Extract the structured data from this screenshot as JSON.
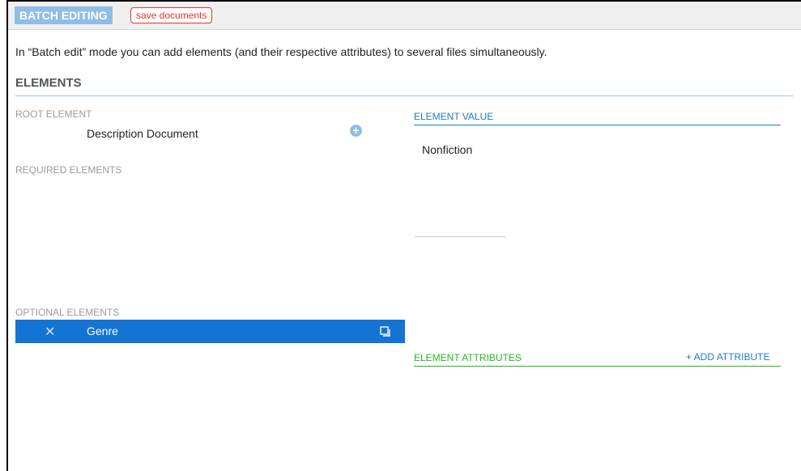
{
  "toolbar": {
    "badge_label": "BATCH EDITING",
    "save_label": "save documents"
  },
  "intro_text": "In “Batch edit” mode you can add elements (and their respective attributes) to several files simultaneously.",
  "elements": {
    "title": "ELEMENTS",
    "root_label": "ROOT ELEMENT",
    "root_value": "Description Document",
    "required_label": "REQUIRED ELEMENTS",
    "optional_label": "OPTIONAL ELEMENTS",
    "optional_items": [
      {
        "label": "Genre"
      }
    ]
  },
  "element_value": {
    "title": "ELEMENT VALUE",
    "value": "Nonfiction"
  },
  "element_attributes": {
    "title": "ELEMENT ATTRIBUTES",
    "add_label": "+ ADD ATTRIBUTE"
  },
  "colors": {
    "badge_bg": "#8fbde6",
    "save_red": "#e3362b",
    "blue": "#1f7cc8",
    "selected_row": "#1474d4",
    "green": "#21b91e"
  },
  "icons": {
    "add": "plus-circle-icon",
    "remove": "close-icon",
    "duplicate": "duplicate-icon"
  }
}
